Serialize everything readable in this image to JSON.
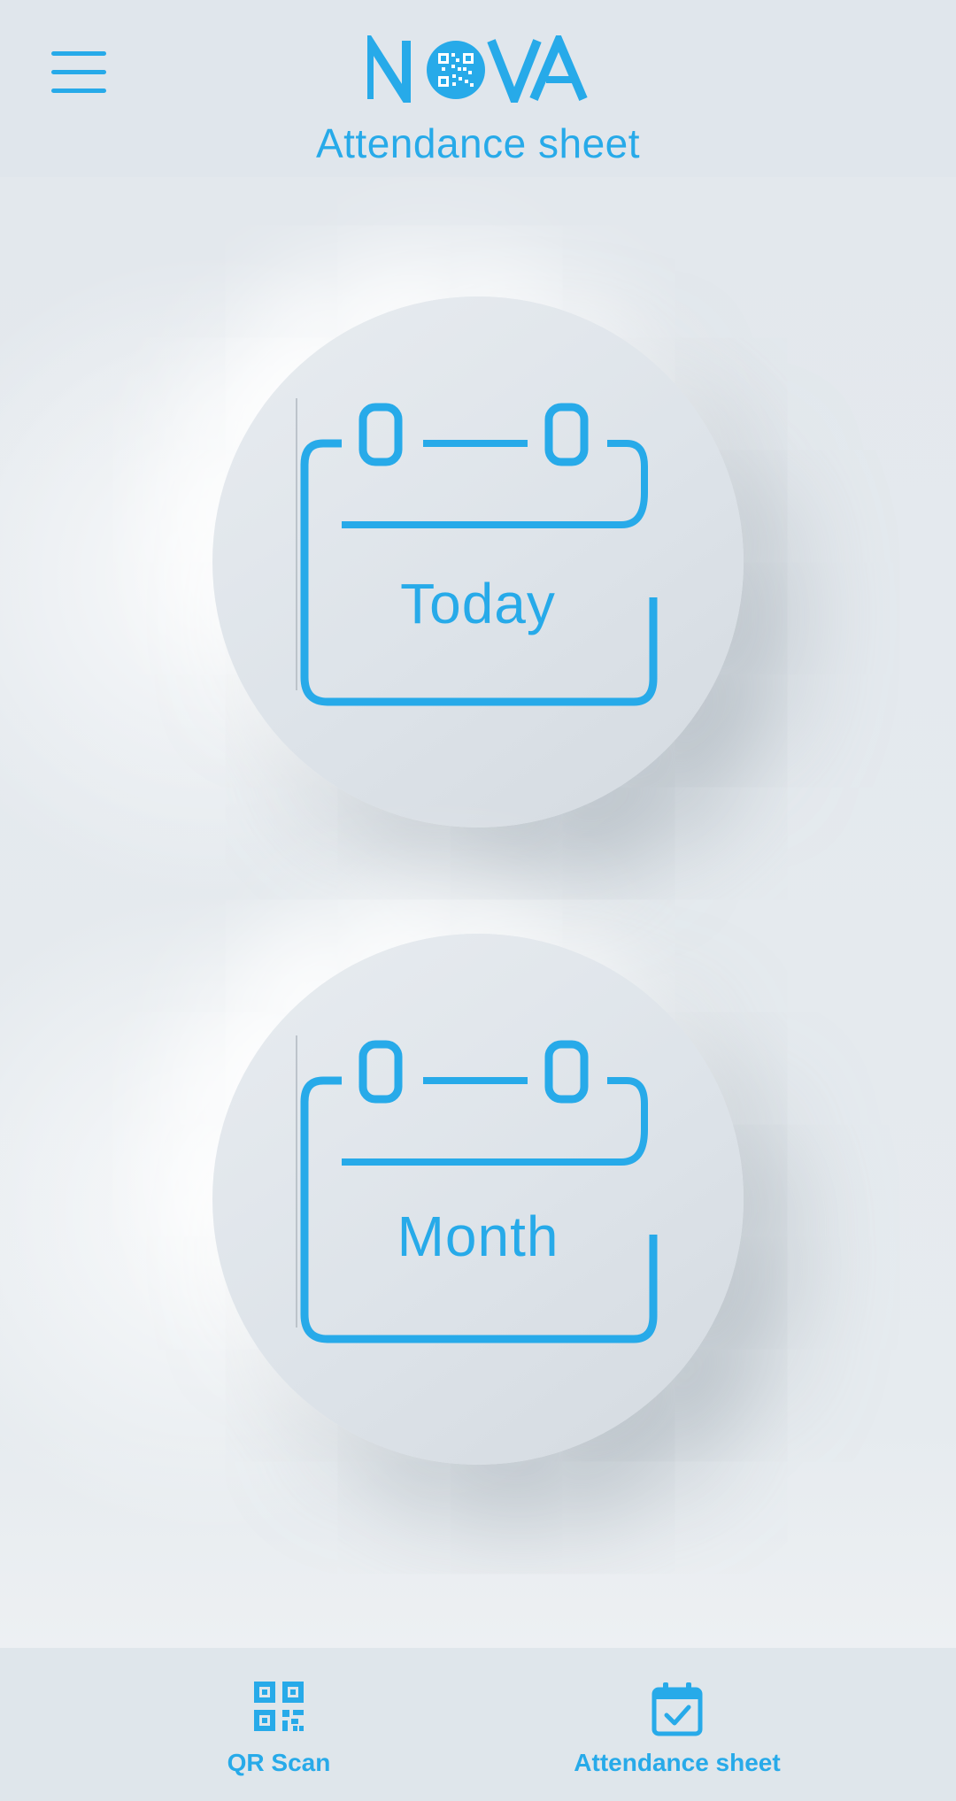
{
  "header": {
    "menu_icon": "hamburger-menu-icon",
    "logo_text": "NOVA",
    "title": "Attendance sheet"
  },
  "main": {
    "buttons": [
      {
        "label": "Today",
        "icon": "calendar-icon"
      },
      {
        "label": "Month",
        "icon": "calendar-icon"
      }
    ]
  },
  "bottom_nav": {
    "items": [
      {
        "label": "QR Scan",
        "icon": "qr-code-icon"
      },
      {
        "label": "Attendance sheet",
        "icon": "calendar-check-icon"
      }
    ]
  },
  "colors": {
    "accent": "#27aae9",
    "background": "#e0e6ec"
  }
}
